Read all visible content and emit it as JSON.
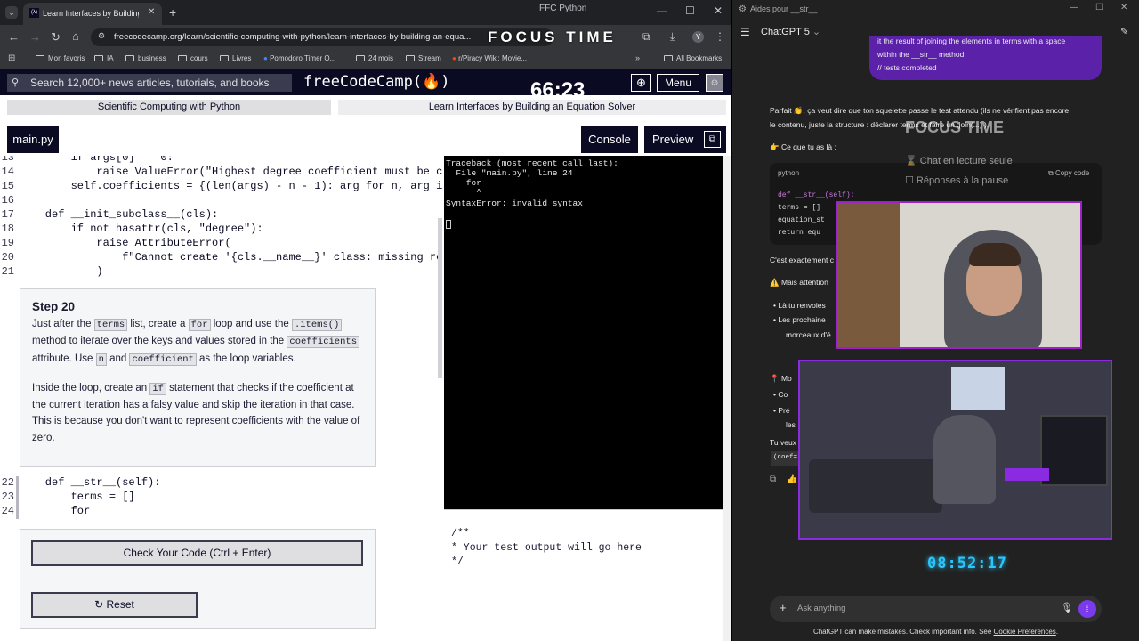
{
  "window": {
    "title": "FFC Python"
  },
  "browser": {
    "tab_title": "Learn Interfaces by Building an",
    "url": "freecodecamp.org/learn/scientific-computing-with-python/learn-interfaces-by-building-an-equa...",
    "focus_overlay": "FOCUS TIME",
    "bookmarks": [
      "Mon favoris",
      "IA",
      "business",
      "cours",
      "Livres",
      "Pomodoro Timer O...",
      "24 mois",
      "Stream",
      "r/Piracy Wiki: Movie...",
      "All Bookmarks"
    ]
  },
  "fcc": {
    "search_placeholder": "Search 12,000+ news articles, tutorials, and books",
    "logo": "freeCodeCamp(🔥)",
    "timer": "66:23",
    "menu_label": "Menu",
    "breadcrumb_course": "Scientific Computing with Python",
    "breadcrumb_lesson": "Learn Interfaces by Building an Equation Solver",
    "file_tab": "main.py",
    "console_label": "Console",
    "preview_label": "Preview"
  },
  "editor": {
    "lines_top": [
      {
        "n": "13",
        "code": "        if args[0] == 0:"
      },
      {
        "n": "14",
        "code": "            raise ValueError(\"Highest degree coefficient must be c"
      },
      {
        "n": "15",
        "code": "        self.coefficients = {(len(args) - n - 1): arg for n, arg i"
      },
      {
        "n": "16",
        "code": ""
      },
      {
        "n": "17",
        "code": "    def __init_subclass__(cls):"
      },
      {
        "n": "18",
        "code": "        if not hasattr(cls, \"degree\"):"
      },
      {
        "n": "19",
        "code": "            raise AttributeError("
      },
      {
        "n": "20",
        "code": "                f\"Cannot create '{cls.__name__}' class: missing re"
      },
      {
        "n": "21",
        "code": "            )"
      }
    ],
    "lines_bottom": [
      {
        "n": "22",
        "code": "    def __str__(self):"
      },
      {
        "n": "23",
        "code": "        terms = []"
      },
      {
        "n": "24",
        "code": "        for"
      }
    ]
  },
  "step": {
    "title": "Step 20",
    "p1_a": "Just after the ",
    "p1_terms": "terms",
    "p1_b": " list, create a ",
    "p1_for": "for",
    "p1_c": " loop and use the ",
    "p1_items": ".items()",
    "p1_d": " method to iterate over the keys and values stored in the ",
    "p1_coefficients": "coefficients",
    "p1_e": " attribute. Use ",
    "p1_n": "n",
    "p1_f": " and ",
    "p1_coefficient": "coefficient",
    "p1_g": " as the loop variables.",
    "p2_a": "Inside the loop, create an ",
    "p2_if": "if",
    "p2_b": " statement that checks if the coefficient at the current iteration has a falsy value and skip the iteration in that case. This is because you don't want to represent coefficients with the value of zero."
  },
  "buttons": {
    "check": "Check Your Code (Ctrl + Enter)",
    "reset": "Reset"
  },
  "terminal": {
    "lines": [
      "Traceback (most recent call last):",
      "  File \"main.py\", line 24",
      "    for",
      "      ^",
      "SyntaxError: invalid syntax"
    ]
  },
  "test_output": {
    "lines": [
      "/**",
      "* Your test output will go here",
      "*/"
    ]
  },
  "chatgpt": {
    "window_title": "Aides pour __str__",
    "model": "ChatGPT 5",
    "user_msg": [
      "it the result of joining the elements in terms with a space",
      "within the __str__ method.",
      "// tests completed"
    ],
    "p1": "Parfait 👏, ça veut dire que ton squelette passe le test attendu (ils ne vérifient pas encore",
    "p2": "le contenu, juste la structure : déclarer terms et faire un .join(...) ).",
    "p3": "👉 Ce que tu as là :",
    "code_lang": "python",
    "copy_label": "Copy code",
    "code_lines": [
      "def __str__(self):",
      "    terms = []",
      "    equation_st",
      "    return equ"
    ],
    "p4": "C'est exactement c",
    "p5": "⚠️ Mais attention",
    "b1": "Là tu renvoies",
    "b2": "Les prochaine",
    "b2b": "morceaux d'é",
    "p6": "📍 Mo",
    "b3": "Co",
    "b4": "Pré",
    "b4b": "les",
    "p7": "Tu veux",
    "p8": "(coef=",
    "overlay_title": "FOCUS TIME",
    "overlay_1": "Chat en lecture seule",
    "overlay_2": "Réponses à la pause",
    "clock": "08:52:17",
    "input_placeholder": "Ask anything",
    "footer_a": "ChatGPT can make mistakes. Check important info. See ",
    "footer_link": "Cookie Preferences",
    "footer_b": "."
  },
  "colors": {
    "fcc_dark": "#0a0a23",
    "chat_bg": "#212121",
    "user_bubble": "#5b21a8",
    "cam_border": "#a020c8",
    "clock": "#28c8ff"
  }
}
